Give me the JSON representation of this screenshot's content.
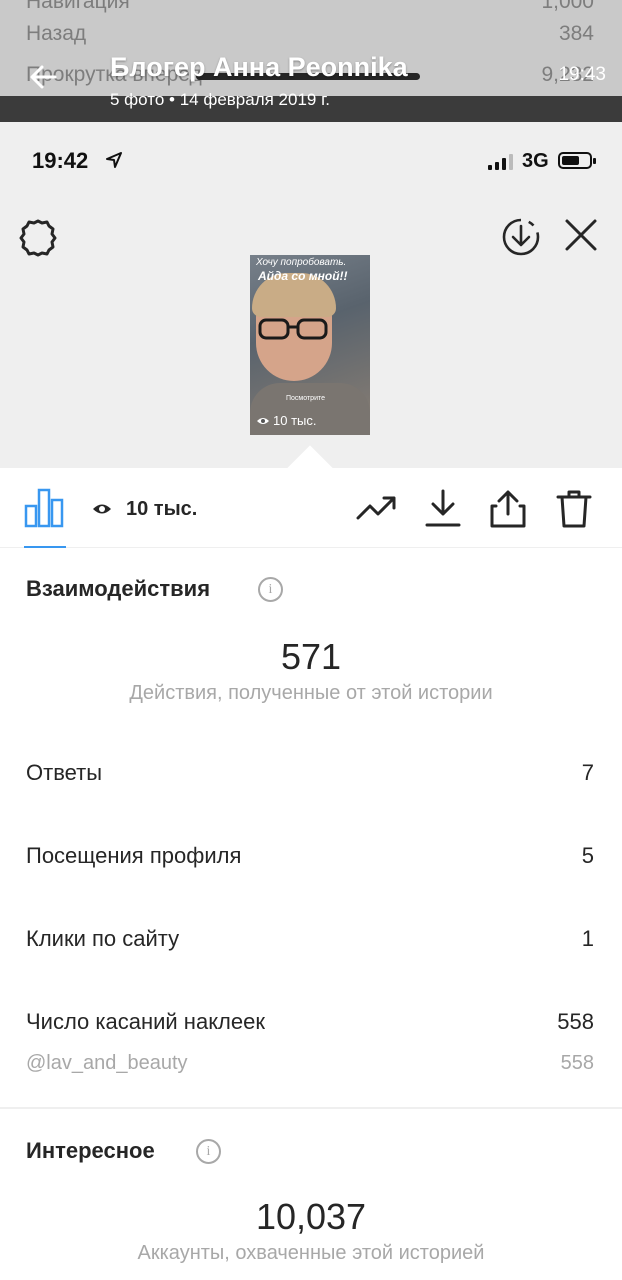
{
  "viewer": {
    "title": "Блогер Анна Peonnika",
    "subtitle": "5 фото  •  14 февраля 2019 г.",
    "time": "19:43",
    "under_rows": [
      {
        "label": "Навигация",
        "value": "1,000"
      },
      {
        "label": "Назад",
        "value": "384"
      },
      {
        "label": "Прокрутка вперед",
        "value": "9,232"
      }
    ]
  },
  "statusbar": {
    "time": "19:42",
    "network": "3G"
  },
  "story": {
    "line1": "Хочу попробовать.",
    "line2": "Айда со мной!!",
    "caption": "Посмотрите",
    "views": "10 тыс."
  },
  "toolbar": {
    "views": "10 тыс."
  },
  "interactions": {
    "title": "Взаимодействия",
    "info": "i",
    "total": "571",
    "caption": "Действия, полученные от этой истории",
    "rows": [
      {
        "label": "Ответы",
        "value": "7"
      },
      {
        "label": "Посещения профиля",
        "value": "5"
      },
      {
        "label": "Клики по сайту",
        "value": "1"
      },
      {
        "label": "Число касаний наклеек",
        "value": "558"
      }
    ],
    "sub_row": {
      "label": "@lav_and_beauty",
      "value": "558"
    }
  },
  "discovery": {
    "title": "Интересное",
    "info": "i",
    "total": "10,037",
    "caption": "Аккаунты, охваченные этой историей"
  },
  "colors": {
    "accent": "#3897f0",
    "text": "#262626",
    "muted": "#a8a8a8",
    "panel": "#efefef"
  }
}
